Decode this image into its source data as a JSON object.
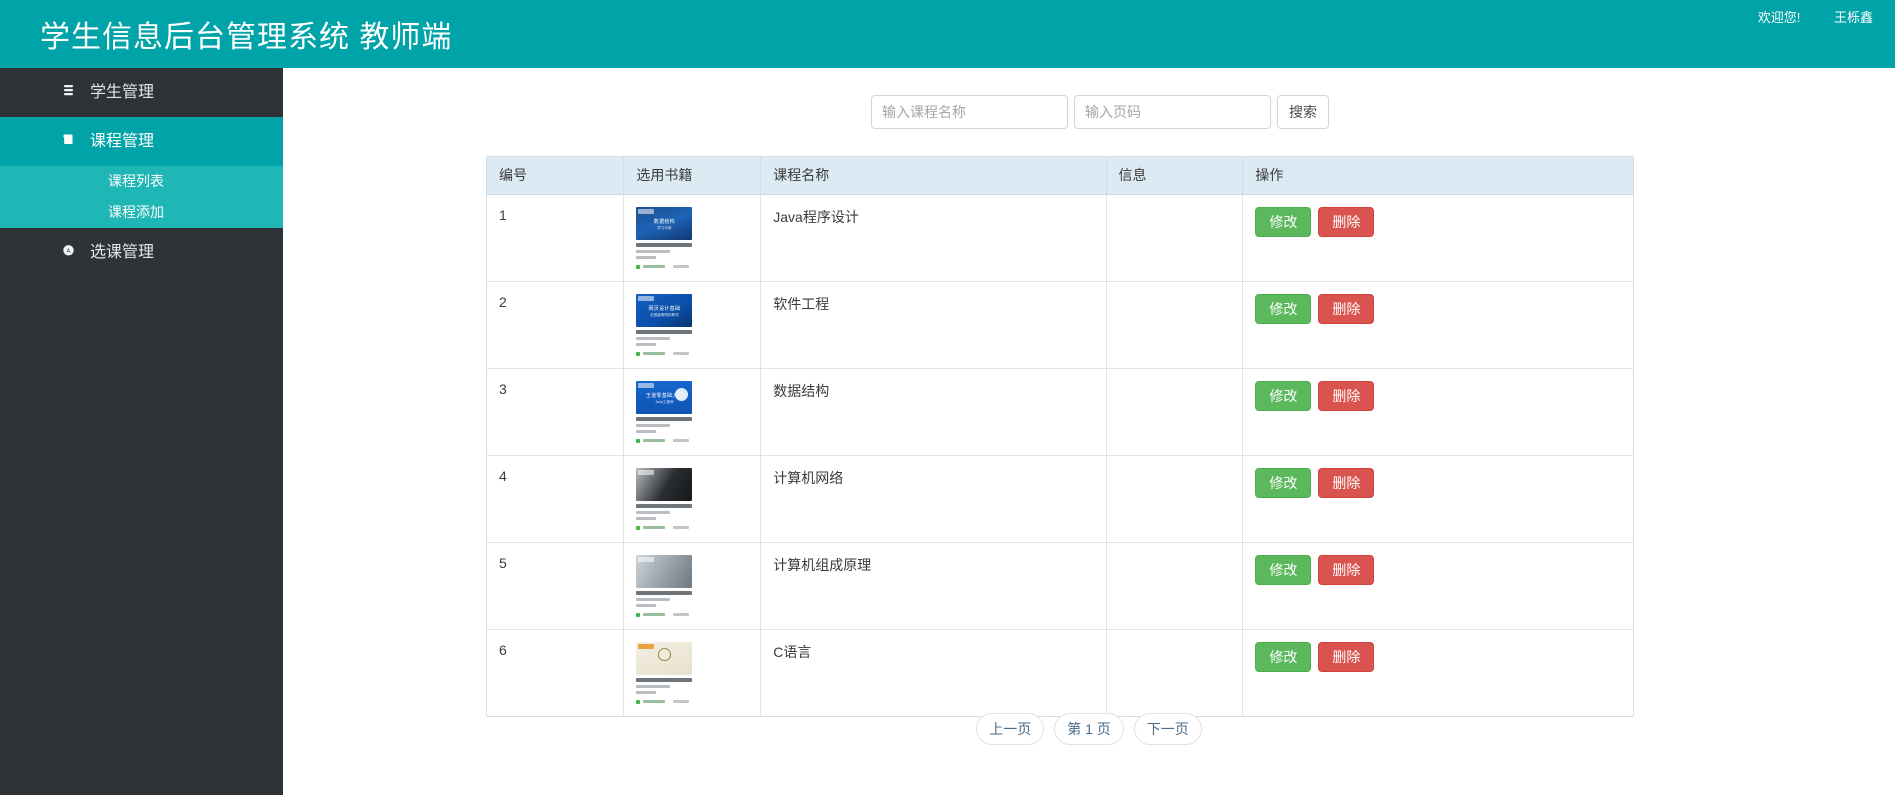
{
  "header": {
    "title": "学生信息后台管理系统 教师端",
    "welcome_text": "欢迎您!",
    "user_name": "王栎鑫",
    "background_color": "#00a4a8"
  },
  "sidebar": {
    "background_color": "#2f3237",
    "active_color": "#00a4a8",
    "submenu_color": "#1fb6b6",
    "items": [
      {
        "label": "学生管理",
        "icon": "list-icon",
        "active": false
      },
      {
        "label": "课程管理",
        "icon": "book-icon",
        "active": true
      },
      {
        "label": "选课管理",
        "icon": "api-icon",
        "active": false
      }
    ],
    "submenu": [
      {
        "label": "课程列表"
      },
      {
        "label": "课程添加"
      }
    ]
  },
  "search": {
    "course_name_placeholder": "输入课程名称",
    "course_name_value": "",
    "page_placeholder": "输入页码",
    "page_value": "",
    "button_label": "搜索"
  },
  "table": {
    "columns": [
      "编号",
      "选用书籍",
      "课程名称",
      "信息",
      "操作"
    ],
    "rows": [
      {
        "id": "1",
        "course": "Java程序设计",
        "info": "",
        "book": {
          "cover_class": "bc-1",
          "cover_title": "数据结构",
          "cover_sub": "学习手册"
        },
        "edit_label": "修改",
        "delete_label": "删除"
      },
      {
        "id": "2",
        "course": "软件工程",
        "info": "",
        "book": {
          "cover_class": "bc-2",
          "cover_title": "网页设计基础",
          "cover_sub": "全国高等院校教材"
        },
        "edit_label": "修改",
        "delete_label": "删除"
      },
      {
        "id": "3",
        "course": "数据结构",
        "info": "",
        "book": {
          "cover_class": "bc-3",
          "cover_title": "王道零基础入门",
          "cover_sub": "Java工程师"
        },
        "edit_label": "修改",
        "delete_label": "删除"
      },
      {
        "id": "4",
        "course": "计算机网络",
        "info": "",
        "book": {
          "cover_class": "bc-4",
          "cover_title": "",
          "cover_sub": ""
        },
        "edit_label": "修改",
        "delete_label": "删除"
      },
      {
        "id": "5",
        "course": "计算机组成原理",
        "info": "",
        "book": {
          "cover_class": "bc-5",
          "cover_title": "",
          "cover_sub": ""
        },
        "edit_label": "修改",
        "delete_label": "删除"
      },
      {
        "id": "6",
        "course": "C语言",
        "info": "",
        "book": {
          "cover_class": "bc-6",
          "cover_title": "",
          "cover_sub": ""
        },
        "edit_label": "修改",
        "delete_label": "删除"
      }
    ]
  },
  "pagination": {
    "prev_label": "上一页",
    "current_label": "第 1 页",
    "next_label": "下一页"
  },
  "colors": {
    "edit_button": "#5cb85c",
    "delete_button": "#d9534f",
    "table_header": "#dbeaf3"
  }
}
